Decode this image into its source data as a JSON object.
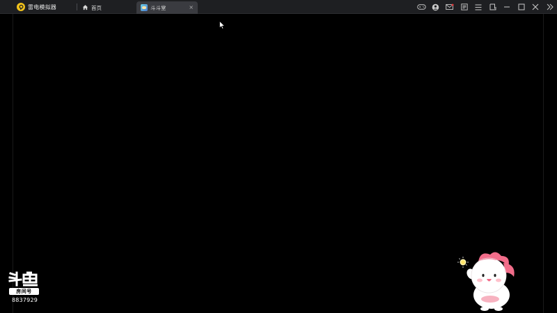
{
  "titlebar": {
    "app_name": "雷电模拟器",
    "tabs": [
      {
        "label": "首页",
        "active": false
      },
      {
        "label": "斗斗堂",
        "active": true,
        "close_label": "×"
      }
    ],
    "toolbar_icons": [
      "gamepad-icon",
      "user-icon",
      "mail-icon",
      "edit-icon",
      "menu-icon",
      "fullscreen-crop-icon",
      "minimize-icon",
      "maximize-icon",
      "close-icon",
      "expand-sidebar-icon"
    ]
  },
  "watermark": {
    "platform_logo": "斗鱼",
    "badge": "房间号",
    "room_number": "8837929"
  },
  "colors": {
    "titlebar_bg": "#1e1f22",
    "active_tab_bg": "#3a3b40",
    "brand_yellow": "#f2c21b",
    "screen_bg": "#000000",
    "mascot_pink": "#f26d8a"
  }
}
